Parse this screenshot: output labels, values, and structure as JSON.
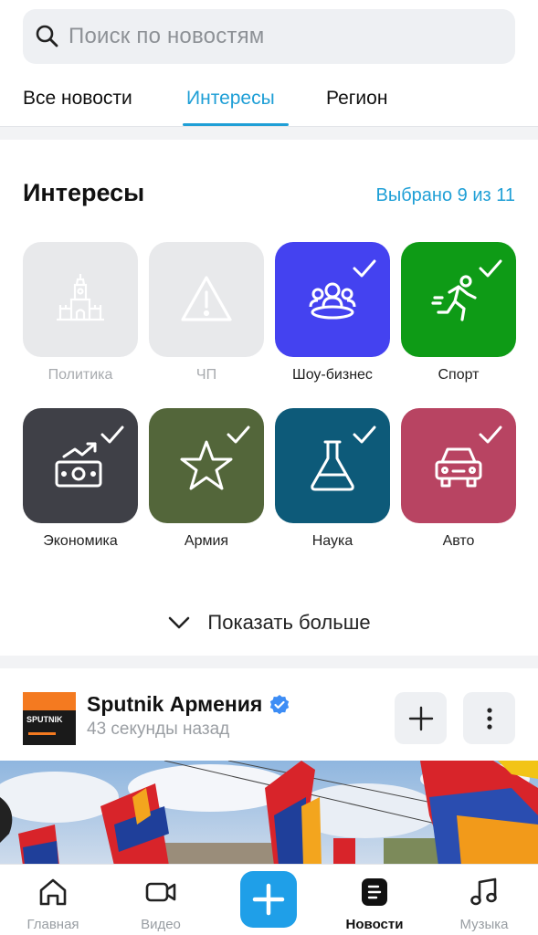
{
  "search": {
    "placeholder": "Поиск по новостям"
  },
  "tabs": [
    {
      "label": "Все новости",
      "active": false
    },
    {
      "label": "Интересы",
      "active": true
    },
    {
      "label": "Регион",
      "active": false
    }
  ],
  "interests": {
    "title": "Интересы",
    "selected_text": "Выбрано 9 из 11",
    "items": [
      {
        "label": "Политика",
        "icon": "kremlin-icon",
        "selected": false,
        "color": "#e8e9eb"
      },
      {
        "label": "ЧП",
        "icon": "warning-icon",
        "selected": false,
        "color": "#e8e9eb"
      },
      {
        "label": "Шоу-бизнес",
        "icon": "show-business-icon",
        "selected": true,
        "color": "#4442f0"
      },
      {
        "label": "Спорт",
        "icon": "running-man-icon",
        "selected": true,
        "color": "#0e9b16"
      },
      {
        "label": "Экономика",
        "icon": "money-growth-icon",
        "selected": true,
        "color": "#3f4047"
      },
      {
        "label": "Армия",
        "icon": "star-icon",
        "selected": true,
        "color": "#53663a"
      },
      {
        "label": "Наука",
        "icon": "flask-icon",
        "selected": true,
        "color": "#0d5a79"
      },
      {
        "label": "Авто",
        "icon": "car-icon",
        "selected": true,
        "color": "#b84462"
      }
    ],
    "show_more": "Показать больше"
  },
  "post": {
    "source": "Sputnik Армения",
    "time": "43 секунды назад",
    "logo_text": "SPUTNIK"
  },
  "bottom_nav": [
    {
      "label": "Главная",
      "icon": "home-icon",
      "active": false
    },
    {
      "label": "Видео",
      "icon": "video-camera-icon",
      "active": false
    },
    {
      "label": "",
      "icon": "plus-icon",
      "active": false
    },
    {
      "label": "Новости",
      "icon": "news-icon",
      "active": true
    },
    {
      "label": "Музыка",
      "icon": "music-note-icon",
      "active": false
    }
  ],
  "colors": {
    "accent": "#1f9fd6",
    "plus_button": "#1f9fe8"
  }
}
